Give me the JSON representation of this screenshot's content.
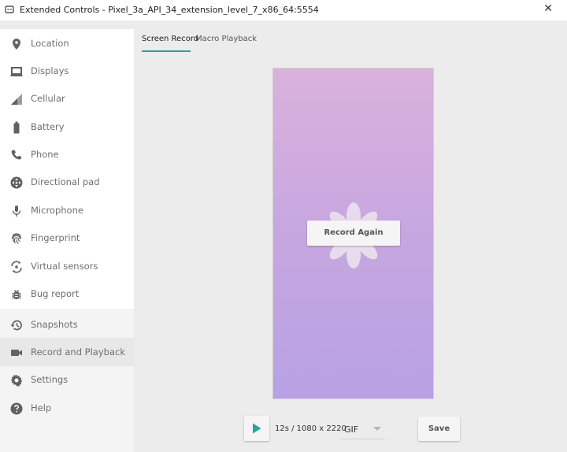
{
  "window": {
    "title": "Extended Controls - Pixel_3a_API_34_extension_level_7_x86_64:5554",
    "close_glyph": "✕",
    "accent_color": "#26a69a"
  },
  "sidebar": {
    "items": [
      {
        "label": "Location",
        "icon": "location-pin-icon"
      },
      {
        "label": "Displays",
        "icon": "laptop-display-icon"
      },
      {
        "label": "Cellular",
        "icon": "cellular-signal-icon"
      },
      {
        "label": "Battery",
        "icon": "battery-icon"
      },
      {
        "label": "Phone",
        "icon": "phone-icon"
      },
      {
        "label": "Directional pad",
        "icon": "dpad-icon"
      },
      {
        "label": "Microphone",
        "icon": "microphone-icon"
      },
      {
        "label": "Fingerprint",
        "icon": "fingerprint-icon"
      },
      {
        "label": "Virtual sensors",
        "icon": "rotation-sensor-icon"
      },
      {
        "label": "Bug report",
        "icon": "bug-icon"
      },
      {
        "label": "Snapshots",
        "icon": "history-icon"
      },
      {
        "label": "Record and Playback",
        "icon": "videocam-icon",
        "active": true
      },
      {
        "label": "Settings",
        "icon": "gear-icon"
      },
      {
        "label": "Help",
        "icon": "help-icon"
      }
    ]
  },
  "tabs": [
    {
      "label": "Screen Record",
      "active": true
    },
    {
      "label": "Macro Playback",
      "active": false
    }
  ],
  "preview": {
    "overlay_button": "Record Again"
  },
  "controls": {
    "info": "12s / 1080 x 2220",
    "format": "GIF",
    "save_label": "Save"
  }
}
